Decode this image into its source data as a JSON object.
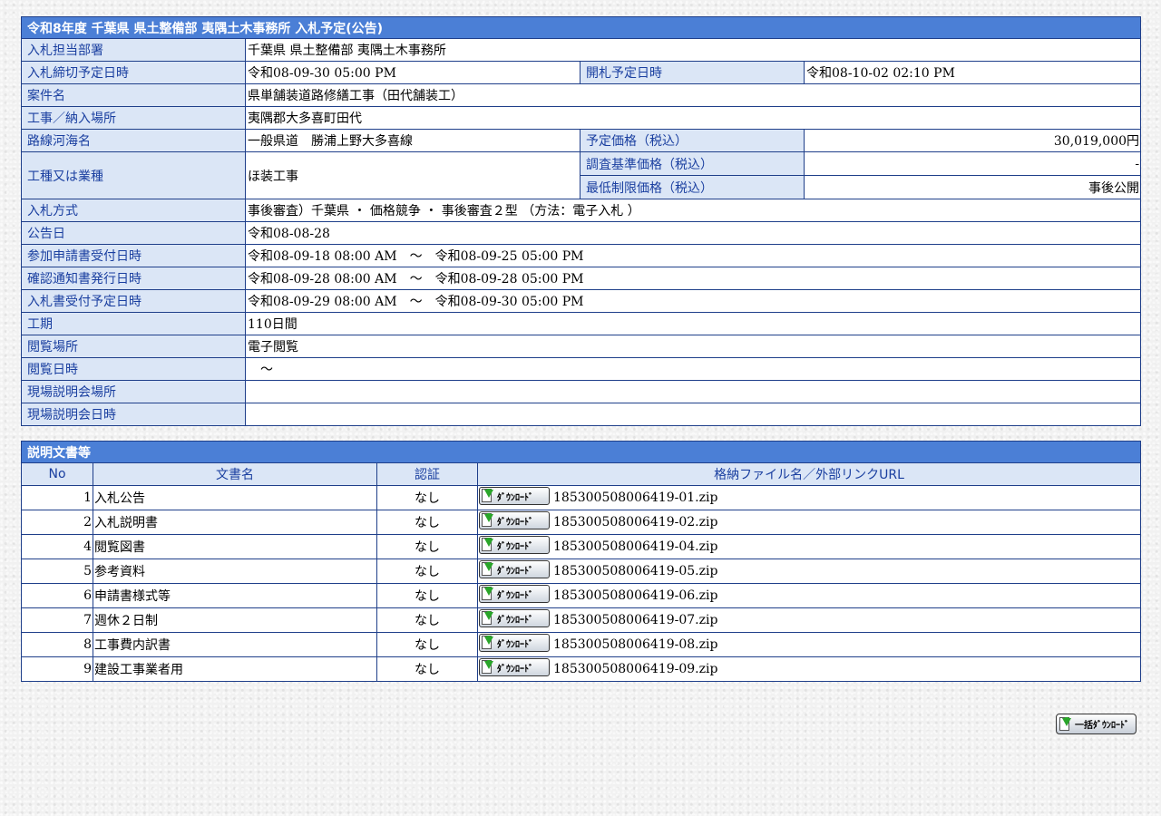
{
  "info": {
    "title": "令和8年度 千葉県 県土整備部 夷隅土木事務所 入札予定(公告)",
    "rows": {
      "dept_label": "入札担当部署",
      "dept_value": "千葉県 県土整備部 夷隅土木事務所",
      "deadline_label": "入札締切予定日時",
      "deadline_value": "令和08-09-30 05:00 PM",
      "opening_label": "開札予定日時",
      "opening_value": "令和08-10-02 02:10 PM",
      "case_label": "案件名",
      "case_value": "県単舗装道路修繕工事（田代舗装工）",
      "place_label": "工事／納入場所",
      "place_value": "夷隅郡大多喜町田代",
      "route_label": "路線河海名",
      "route_value": "一般県道　勝浦上野大多喜線",
      "price_label": "予定価格（税込）",
      "price_value": "30,019,000円",
      "type_label": "工種又は業種",
      "type_value": "ほ装工事",
      "survey_label": "調査基準価格（税込）",
      "survey_value": "-",
      "minimum_label": "最低制限価格（税込）",
      "minimum_value": "事後公開",
      "method_label": "入札方式",
      "method_value": "事後審査）千葉県 ・ 価格競争 ・ 事後審査２型 （方法：電子入札 ）",
      "notice_label": "公告日",
      "notice_value": "令和08-08-28",
      "apply_label": "参加申請書受付日時",
      "apply_value": "令和08-09-18 08:00 AM　～　令和08-09-25 05:00 PM",
      "confirm_label": "確認通知書発行日時",
      "confirm_value": "令和08-09-28 08:00 AM　～　令和08-09-28 05:00 PM",
      "receive_label": "入札書受付予定日時",
      "receive_value": "令和08-09-29 08:00 AM　～　令和08-09-30 05:00 PM",
      "period_label": "工期",
      "period_value": "110日間",
      "view_place_label": "閲覧場所",
      "view_place_value": "電子閲覧",
      "view_date_label": "閲覧日時",
      "view_date_value": "　～",
      "site_place_label": "現場説明会場所",
      "site_place_value": "",
      "site_date_label": "現場説明会日時",
      "site_date_value": ""
    }
  },
  "docs": {
    "title": "説明文書等",
    "headers": {
      "no": "No",
      "name": "文書名",
      "auth": "認証",
      "file": "格納ファイル名／外部リンクURL"
    },
    "download_label": "ﾀﾞｳﾝﾛｰﾄﾞ",
    "rows": [
      {
        "no": "1",
        "name": "入札公告",
        "auth": "なし",
        "file": "185300508006419-01.zip"
      },
      {
        "no": "2",
        "name": "入札説明書",
        "auth": "なし",
        "file": "185300508006419-02.zip"
      },
      {
        "no": "4",
        "name": "閲覧図書",
        "auth": "なし",
        "file": "185300508006419-04.zip"
      },
      {
        "no": "5",
        "name": "参考資料",
        "auth": "なし",
        "file": "185300508006419-05.zip"
      },
      {
        "no": "6",
        "name": "申請書様式等",
        "auth": "なし",
        "file": "185300508006419-06.zip"
      },
      {
        "no": "7",
        "name": "週休２日制",
        "auth": "なし",
        "file": "185300508006419-07.zip"
      },
      {
        "no": "8",
        "name": "工事費内訳書",
        "auth": "なし",
        "file": "185300508006419-08.zip"
      },
      {
        "no": "9",
        "name": "建設工事業者用",
        "auth": "なし",
        "file": "185300508006419-09.zip"
      }
    ]
  },
  "bulk_download_label": "一括ﾀﾞｳﾝﾛｰﾄﾞ",
  "icons": {
    "download": "download-arrow-icon"
  },
  "colors": {
    "header": "#4b7fd6",
    "label_bg": "#dbe6f6",
    "label_text": "#1a3fa0",
    "border": "#1f3f8a"
  }
}
